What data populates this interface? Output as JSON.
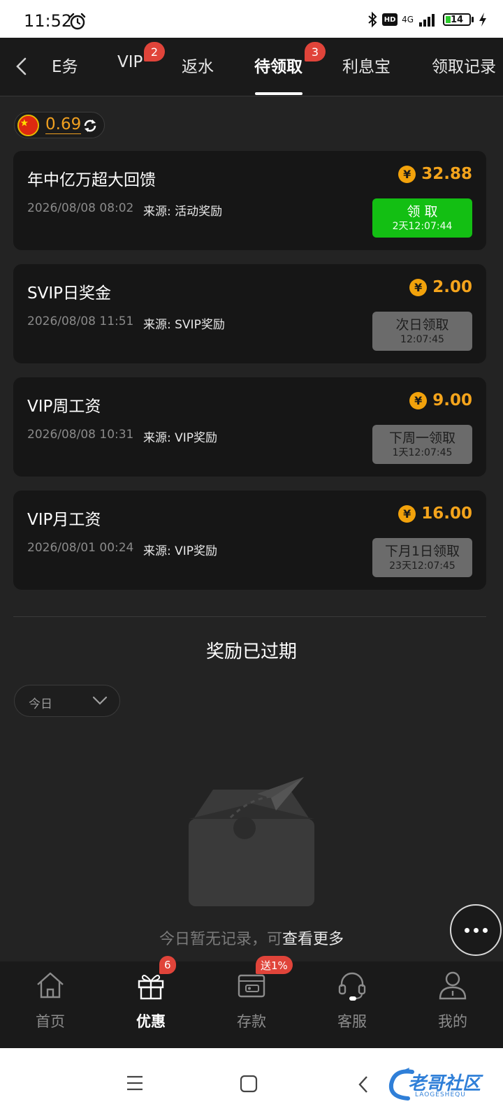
{
  "status_bar": {
    "time": "11:52",
    "network": "4G",
    "battery": "14"
  },
  "nav": {
    "tabs": [
      {
        "label": "E务"
      },
      {
        "label": "VIP",
        "badge": "2"
      },
      {
        "label": "返水"
      },
      {
        "label": "待领取",
        "badge": "3",
        "active": true
      },
      {
        "label": "利息宝"
      },
      {
        "label": "领取记录"
      }
    ]
  },
  "balance": {
    "value": "0.69"
  },
  "rewards": [
    {
      "title": "年中亿万超大回馈",
      "date": "2026/08/08 08:02",
      "source": "来源: 活动奖励",
      "amount": "32.88",
      "button_label": "领 取",
      "button_timer": "2天12:07:44",
      "button_state": "active"
    },
    {
      "title": "SVIP日奖金",
      "date": "2026/08/08 11:51",
      "source": "来源: SVIP奖励",
      "amount": "2.00",
      "button_label": "次日领取",
      "button_timer": "12:07:45",
      "button_state": "disabled"
    },
    {
      "title": "VIP周工资",
      "date": "2026/08/08 10:31",
      "source": "来源: VIP奖励",
      "amount": "9.00",
      "button_label": "下周一领取",
      "button_timer": "1天12:07:45",
      "button_state": "disabled"
    },
    {
      "title": "VIP月工资",
      "date": "2026/08/01 00:24",
      "source": "来源: VIP奖励",
      "amount": "16.00",
      "button_label": "下月1日领取",
      "button_timer": "23天12:07:45",
      "button_state": "disabled"
    }
  ],
  "expired": {
    "heading": "奖励已过期",
    "date_filter": "今日",
    "empty_text": "今日暂无记录，可",
    "empty_link": "查看更多"
  },
  "bottom_nav": [
    {
      "label": "首页",
      "icon": "home-icon"
    },
    {
      "label": "优惠",
      "icon": "gift-icon",
      "badge": "6",
      "active": true
    },
    {
      "label": "存款",
      "icon": "wallet-icon",
      "badge": "送1%"
    },
    {
      "label": "客服",
      "icon": "headset-icon"
    },
    {
      "label": "我的",
      "icon": "user-icon"
    }
  ],
  "watermark": {
    "text": "老哥社区",
    "sub": "LAOGESHEQU"
  },
  "colors": {
    "accent": "#f4a41c",
    "claim_green": "#13bf13",
    "badge_red": "#e0443a",
    "background": "#232323"
  }
}
